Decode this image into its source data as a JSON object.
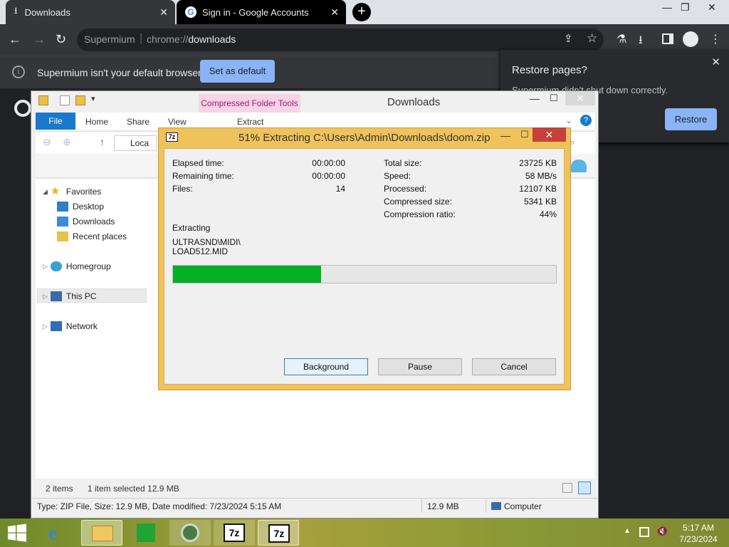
{
  "chrome": {
    "tabs": [
      {
        "label": "Downloads"
      },
      {
        "label": "Sign in - Google Accounts"
      }
    ],
    "omnibox": {
      "host": "Supermium",
      "url_prefix": "chrome://",
      "url_path": "downloads"
    },
    "infobar": {
      "text": "Supermium isn't your default browser",
      "button": "Set as default"
    },
    "restore": {
      "title": "Restore pages?",
      "subtitle": "Supermium didn't shut down correctly.",
      "button": "Restore"
    }
  },
  "explorer": {
    "title": "Downloads",
    "context_tab": "Compressed Folder Tools",
    "context_sub": "Extract",
    "ribbon_tabs": [
      "File",
      "Home",
      "Share",
      "View"
    ],
    "address_text": "Loca",
    "nav": {
      "favorites": "Favorites",
      "desktop": "Desktop",
      "downloads": "Downloads",
      "recent": "Recent places",
      "homegroup": "Homegroup",
      "thispc": "This PC",
      "network": "Network"
    },
    "status": {
      "items": "2 items",
      "selected": "1 item selected  12.9 MB"
    },
    "details": {
      "info": "Type: ZIP File, Size: 12.9 MB, Date modified: 7/23/2024 5:15 AM",
      "size": "12.9 MB",
      "location": "Computer"
    }
  },
  "zip_dialog": {
    "title": "51% Extracting C:\\Users\\Admin\\Downloads\\doom.zip",
    "left_stats": [
      {
        "label": "Elapsed time:",
        "value": "00:00:00"
      },
      {
        "label": "Remaining time:",
        "value": "00:00:00"
      },
      {
        "label": "Files:",
        "value": "14"
      }
    ],
    "right_stats": [
      {
        "label": "Total size:",
        "value": "23725 KB"
      },
      {
        "label": "Speed:",
        "value": "58 MB/s"
      },
      {
        "label": "Processed:",
        "value": "12107 KB"
      },
      {
        "label": "Compressed size:",
        "value": "5341 KB"
      },
      {
        "label": "Compression ratio:",
        "value": "44%"
      }
    ],
    "status_label": "Extracting",
    "current_file_line1": "ULTRASND\\MIDI\\",
    "current_file_line2": "LOAD512.MID",
    "progress_fraction": 0.386,
    "buttons": {
      "background": "Background",
      "pause": "Pause",
      "cancel": "Cancel"
    }
  },
  "taskbar": {
    "time": "5:17 AM",
    "date": "7/23/2024"
  }
}
